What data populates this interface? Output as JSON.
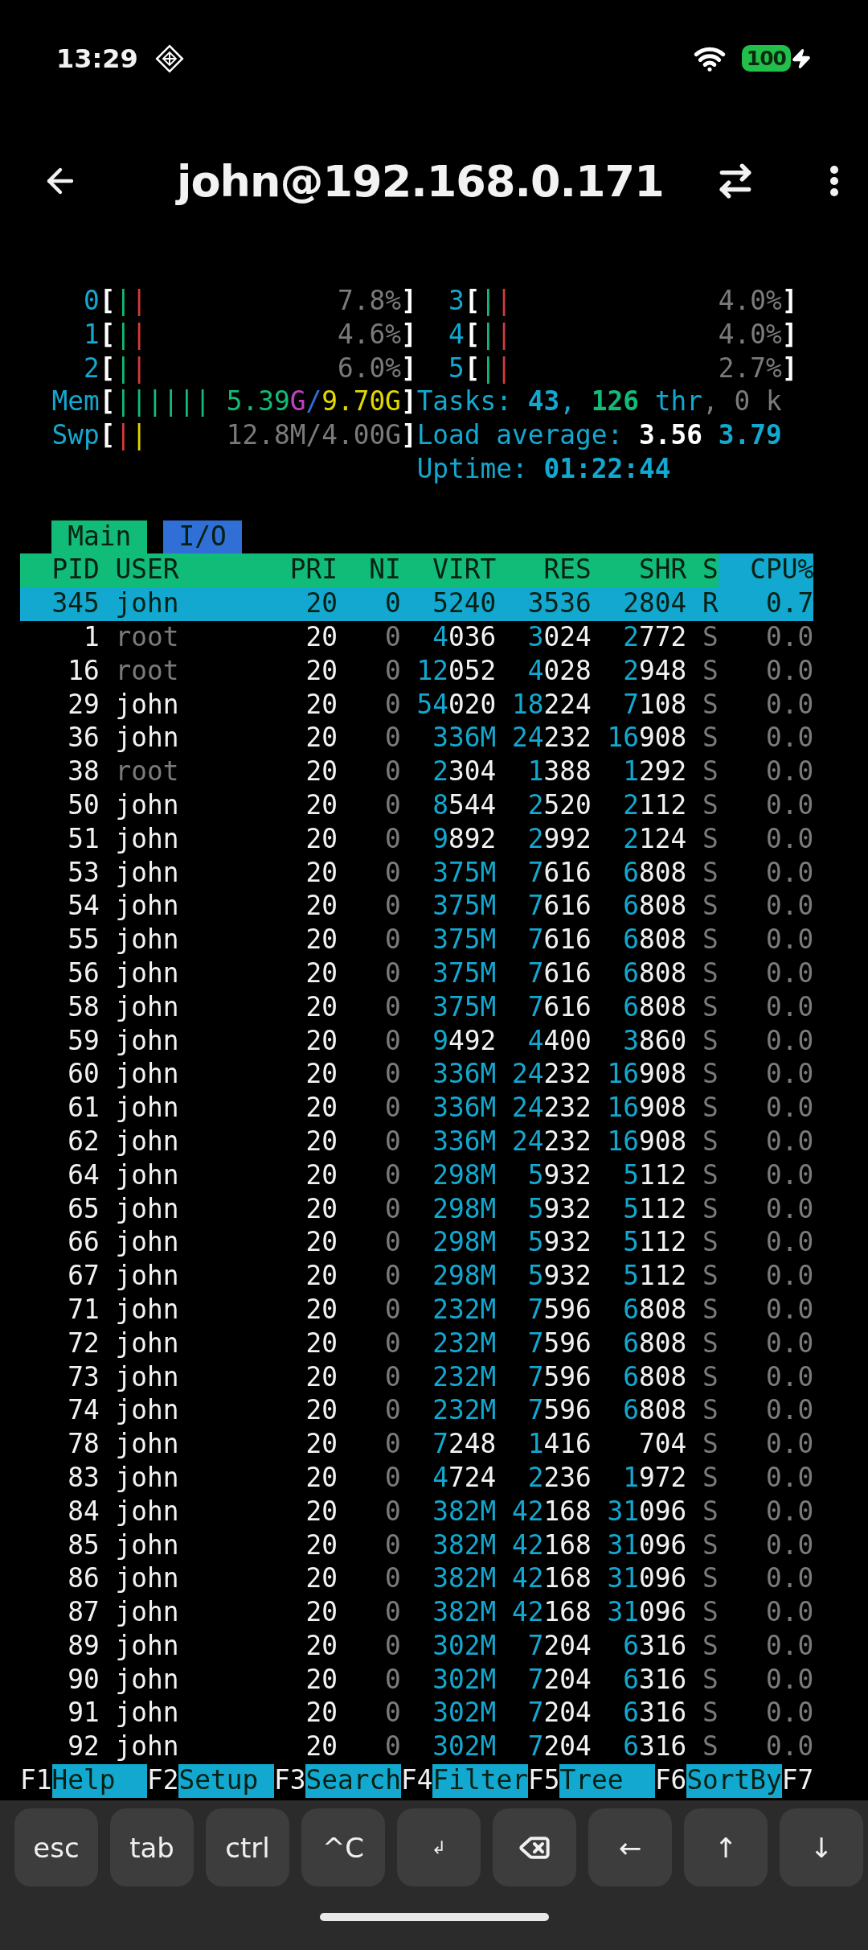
{
  "status_bar": {
    "time": "13:29",
    "battery": "100"
  },
  "app_bar": {
    "title": "john@192.168.0.171"
  },
  "meters": {
    "left": [
      {
        "label": "0",
        "open": "[",
        "bars": [
          {
            "text": "|",
            "color": "#10bc78"
          },
          {
            "text": "|",
            "color": "#d63a3a"
          }
        ],
        "value": [
          {
            "text": "7.8%",
            "color": "#7a7a7a"
          }
        ],
        "close": "]"
      },
      {
        "label": "1",
        "open": "[",
        "bars": [
          {
            "text": "|",
            "color": "#10bc78"
          },
          {
            "text": "|",
            "color": "#d63a3a"
          }
        ],
        "value": [
          {
            "text": "4.6%",
            "color": "#7a7a7a"
          }
        ],
        "close": "]"
      },
      {
        "label": "2",
        "open": "[",
        "bars": [
          {
            "text": "|",
            "color": "#10bc78"
          },
          {
            "text": "|",
            "color": "#d63a3a"
          }
        ],
        "value": [
          {
            "text": "6.0%",
            "color": "#7a7a7a"
          }
        ],
        "close": "]"
      },
      {
        "label": "Mem",
        "open": "[",
        "bars": [
          {
            "text": "||||||",
            "color": "#10bc78"
          }
        ],
        "value": [
          {
            "text": "5.39",
            "color": "#10bc78"
          },
          {
            "text": "G",
            "color": "#c040c0"
          },
          {
            "text": "/",
            "color": "#2f6fd6"
          },
          {
            "text": "9.70G",
            "color": "#e0d800"
          }
        ],
        "close": "]"
      },
      {
        "label": "Swp",
        "open": "[",
        "bars": [
          {
            "text": "|",
            "color": "#d63a3a"
          },
          {
            "text": "|",
            "color": "#e0d800"
          }
        ],
        "value": [
          {
            "text": "12.8M/4.00G",
            "color": "#7a7a7a"
          }
        ],
        "close": "]"
      }
    ],
    "right": [
      {
        "label": "3",
        "open": "[",
        "bars": [
          {
            "text": "|",
            "color": "#10bc78"
          },
          {
            "text": "|",
            "color": "#d63a3a"
          }
        ],
        "value": [
          {
            "text": "4.0%",
            "color": "#7a7a7a"
          }
        ],
        "close": "]"
      },
      {
        "label": "4",
        "open": "[",
        "bars": [
          {
            "text": "|",
            "color": "#10bc78"
          },
          {
            "text": "|",
            "color": "#d63a3a"
          }
        ],
        "value": [
          {
            "text": "4.0%",
            "color": "#7a7a7a"
          }
        ],
        "close": "]"
      },
      {
        "label": "5",
        "open": "[",
        "bars": [
          {
            "text": "|",
            "color": "#10bc78"
          },
          {
            "text": "|",
            "color": "#d63a3a"
          }
        ],
        "value": [
          {
            "text": "2.7%",
            "color": "#7a7a7a"
          }
        ],
        "close": "]"
      },
      {
        "segments": [
          {
            "text": "Tasks: ",
            "color": "#13a8cf",
            "bold": false
          },
          {
            "text": "43",
            "color": "#13a8cf",
            "bold": true
          },
          {
            "text": ", ",
            "color": "#13a8cf",
            "bold": false
          },
          {
            "text": "126",
            "color": "#10bc78",
            "bold": true
          },
          {
            "text": " thr",
            "color": "#13a8cf",
            "bold": false
          },
          {
            "text": ", 0 k",
            "color": "#7a7a7a",
            "bold": false
          }
        ]
      },
      {
        "segments": [
          {
            "text": "Load average: ",
            "color": "#13a8cf",
            "bold": false
          },
          {
            "text": "3.56",
            "color": "#ffffff",
            "bold": true
          },
          {
            "text": " 3.79",
            "color": "#13a8cf",
            "bold": true
          }
        ]
      },
      {
        "segments": [
          {
            "text": "Uptime: ",
            "color": "#13a8cf",
            "bold": false
          },
          {
            "text": "01:22:44",
            "color": "#13a8cf",
            "bold": true
          }
        ]
      }
    ]
  },
  "tabs": [
    {
      "label": "Main",
      "selected": true
    },
    {
      "label": "I/O",
      "selected": false
    }
  ],
  "columns": [
    {
      "label": "PID",
      "sorted": false
    },
    {
      "label": "USER",
      "sorted": false
    },
    {
      "label": "PRI",
      "sorted": false
    },
    {
      "label": "NI",
      "sorted": false
    },
    {
      "label": "VIRT",
      "sorted": false
    },
    {
      "label": "RES",
      "sorted": false
    },
    {
      "label": "SHR",
      "sorted": false
    },
    {
      "label": "S",
      "sorted": false
    },
    {
      "label": "CPU%",
      "sorted": true
    }
  ],
  "processes": [
    {
      "pid": "345",
      "user": "john",
      "pri": "20",
      "ni": "0",
      "virt": "5240",
      "res": "3536",
      "shr": "2804",
      "s": "R",
      "cpu": "0.7",
      "selected": true,
      "other_user": false
    },
    {
      "pid": "1",
      "user": "root",
      "pri": "20",
      "ni": "0",
      "virt": "4036",
      "res": "3024",
      "shr": "2772",
      "s": "S",
      "cpu": "0.0",
      "selected": false,
      "other_user": true
    },
    {
      "pid": "16",
      "user": "root",
      "pri": "20",
      "ni": "0",
      "virt": "12052",
      "res": "4028",
      "shr": "2948",
      "s": "S",
      "cpu": "0.0",
      "selected": false,
      "other_user": true
    },
    {
      "pid": "29",
      "user": "john",
      "pri": "20",
      "ni": "0",
      "virt": "54020",
      "res": "18224",
      "shr": "7108",
      "s": "S",
      "cpu": "0.0",
      "selected": false,
      "other_user": false
    },
    {
      "pid": "36",
      "user": "john",
      "pri": "20",
      "ni": "0",
      "virt": "336M",
      "res": "24232",
      "shr": "16908",
      "s": "S",
      "cpu": "0.0",
      "selected": false,
      "other_user": false
    },
    {
      "pid": "38",
      "user": "root",
      "pri": "20",
      "ni": "0",
      "virt": "2304",
      "res": "1388",
      "shr": "1292",
      "s": "S",
      "cpu": "0.0",
      "selected": false,
      "other_user": true
    },
    {
      "pid": "50",
      "user": "john",
      "pri": "20",
      "ni": "0",
      "virt": "8544",
      "res": "2520",
      "shr": "2112",
      "s": "S",
      "cpu": "0.0",
      "selected": false,
      "other_user": false
    },
    {
      "pid": "51",
      "user": "john",
      "pri": "20",
      "ni": "0",
      "virt": "9892",
      "res": "2992",
      "shr": "2124",
      "s": "S",
      "cpu": "0.0",
      "selected": false,
      "other_user": false
    },
    {
      "pid": "53",
      "user": "john",
      "pri": "20",
      "ni": "0",
      "virt": "375M",
      "res": "7616",
      "shr": "6808",
      "s": "S",
      "cpu": "0.0",
      "selected": false,
      "other_user": false
    },
    {
      "pid": "54",
      "user": "john",
      "pri": "20",
      "ni": "0",
      "virt": "375M",
      "res": "7616",
      "shr": "6808",
      "s": "S",
      "cpu": "0.0",
      "selected": false,
      "other_user": false
    },
    {
      "pid": "55",
      "user": "john",
      "pri": "20",
      "ni": "0",
      "virt": "375M",
      "res": "7616",
      "shr": "6808",
      "s": "S",
      "cpu": "0.0",
      "selected": false,
      "other_user": false
    },
    {
      "pid": "56",
      "user": "john",
      "pri": "20",
      "ni": "0",
      "virt": "375M",
      "res": "7616",
      "shr": "6808",
      "s": "S",
      "cpu": "0.0",
      "selected": false,
      "other_user": false
    },
    {
      "pid": "58",
      "user": "john",
      "pri": "20",
      "ni": "0",
      "virt": "375M",
      "res": "7616",
      "shr": "6808",
      "s": "S",
      "cpu": "0.0",
      "selected": false,
      "other_user": false
    },
    {
      "pid": "59",
      "user": "john",
      "pri": "20",
      "ni": "0",
      "virt": "9492",
      "res": "4400",
      "shr": "3860",
      "s": "S",
      "cpu": "0.0",
      "selected": false,
      "other_user": false
    },
    {
      "pid": "60",
      "user": "john",
      "pri": "20",
      "ni": "0",
      "virt": "336M",
      "res": "24232",
      "shr": "16908",
      "s": "S",
      "cpu": "0.0",
      "selected": false,
      "other_user": false
    },
    {
      "pid": "61",
      "user": "john",
      "pri": "20",
      "ni": "0",
      "virt": "336M",
      "res": "24232",
      "shr": "16908",
      "s": "S",
      "cpu": "0.0",
      "selected": false,
      "other_user": false
    },
    {
      "pid": "62",
      "user": "john",
      "pri": "20",
      "ni": "0",
      "virt": "336M",
      "res": "24232",
      "shr": "16908",
      "s": "S",
      "cpu": "0.0",
      "selected": false,
      "other_user": false
    },
    {
      "pid": "64",
      "user": "john",
      "pri": "20",
      "ni": "0",
      "virt": "298M",
      "res": "5932",
      "shr": "5112",
      "s": "S",
      "cpu": "0.0",
      "selected": false,
      "other_user": false
    },
    {
      "pid": "65",
      "user": "john",
      "pri": "20",
      "ni": "0",
      "virt": "298M",
      "res": "5932",
      "shr": "5112",
      "s": "S",
      "cpu": "0.0",
      "selected": false,
      "other_user": false
    },
    {
      "pid": "66",
      "user": "john",
      "pri": "20",
      "ni": "0",
      "virt": "298M",
      "res": "5932",
      "shr": "5112",
      "s": "S",
      "cpu": "0.0",
      "selected": false,
      "other_user": false
    },
    {
      "pid": "67",
      "user": "john",
      "pri": "20",
      "ni": "0",
      "virt": "298M",
      "res": "5932",
      "shr": "5112",
      "s": "S",
      "cpu": "0.0",
      "selected": false,
      "other_user": false
    },
    {
      "pid": "71",
      "user": "john",
      "pri": "20",
      "ni": "0",
      "virt": "232M",
      "res": "7596",
      "shr": "6808",
      "s": "S",
      "cpu": "0.0",
      "selected": false,
      "other_user": false
    },
    {
      "pid": "72",
      "user": "john",
      "pri": "20",
      "ni": "0",
      "virt": "232M",
      "res": "7596",
      "shr": "6808",
      "s": "S",
      "cpu": "0.0",
      "selected": false,
      "other_user": false
    },
    {
      "pid": "73",
      "user": "john",
      "pri": "20",
      "ni": "0",
      "virt": "232M",
      "res": "7596",
      "shr": "6808",
      "s": "S",
      "cpu": "0.0",
      "selected": false,
      "other_user": false
    },
    {
      "pid": "74",
      "user": "john",
      "pri": "20",
      "ni": "0",
      "virt": "232M",
      "res": "7596",
      "shr": "6808",
      "s": "S",
      "cpu": "0.0",
      "selected": false,
      "other_user": false
    },
    {
      "pid": "78",
      "user": "john",
      "pri": "20",
      "ni": "0",
      "virt": "7248",
      "res": "1416",
      "shr": "704",
      "s": "S",
      "cpu": "0.0",
      "selected": false,
      "other_user": false
    },
    {
      "pid": "83",
      "user": "john",
      "pri": "20",
      "ni": "0",
      "virt": "4724",
      "res": "2236",
      "shr": "1972",
      "s": "S",
      "cpu": "0.0",
      "selected": false,
      "other_user": false
    },
    {
      "pid": "84",
      "user": "john",
      "pri": "20",
      "ni": "0",
      "virt": "382M",
      "res": "42168",
      "shr": "31096",
      "s": "S",
      "cpu": "0.0",
      "selected": false,
      "other_user": false
    },
    {
      "pid": "85",
      "user": "john",
      "pri": "20",
      "ni": "0",
      "virt": "382M",
      "res": "42168",
      "shr": "31096",
      "s": "S",
      "cpu": "0.0",
      "selected": false,
      "other_user": false
    },
    {
      "pid": "86",
      "user": "john",
      "pri": "20",
      "ni": "0",
      "virt": "382M",
      "res": "42168",
      "shr": "31096",
      "s": "S",
      "cpu": "0.0",
      "selected": false,
      "other_user": false
    },
    {
      "pid": "87",
      "user": "john",
      "pri": "20",
      "ni": "0",
      "virt": "382M",
      "res": "42168",
      "shr": "31096",
      "s": "S",
      "cpu": "0.0",
      "selected": false,
      "other_user": false
    },
    {
      "pid": "89",
      "user": "john",
      "pri": "20",
      "ni": "0",
      "virt": "302M",
      "res": "7204",
      "shr": "6316",
      "s": "S",
      "cpu": "0.0",
      "selected": false,
      "other_user": false
    },
    {
      "pid": "90",
      "user": "john",
      "pri": "20",
      "ni": "0",
      "virt": "302M",
      "res": "7204",
      "shr": "6316",
      "s": "S",
      "cpu": "0.0",
      "selected": false,
      "other_user": false
    },
    {
      "pid": "91",
      "user": "john",
      "pri": "20",
      "ni": "0",
      "virt": "302M",
      "res": "7204",
      "shr": "6316",
      "s": "S",
      "cpu": "0.0",
      "selected": false,
      "other_user": false
    },
    {
      "pid": "92",
      "user": "john",
      "pri": "20",
      "ni": "0",
      "virt": "302M",
      "res": "7204",
      "shr": "6316",
      "s": "S",
      "cpu": "0.0",
      "selected": false,
      "other_user": false
    }
  ],
  "function_keys": [
    {
      "key": "F1",
      "label": "Help"
    },
    {
      "key": "F2",
      "label": "Setup"
    },
    {
      "key": "F3",
      "label": "Search"
    },
    {
      "key": "F4",
      "label": "Filter"
    },
    {
      "key": "F5",
      "label": "Tree"
    },
    {
      "key": "F6",
      "label": "SortBy"
    },
    {
      "key": "F7"
    }
  ],
  "extra_keys": [
    {
      "kind": "text",
      "label": "esc"
    },
    {
      "kind": "text",
      "label": "tab"
    },
    {
      "kind": "text",
      "label": "ctrl"
    },
    {
      "kind": "text",
      "label": "^C"
    },
    {
      "kind": "small",
      "label": "↲"
    },
    {
      "kind": "backspace"
    },
    {
      "kind": "text",
      "label": "←"
    },
    {
      "kind": "text",
      "label": "↑"
    },
    {
      "kind": "text",
      "label": "↓"
    }
  ]
}
